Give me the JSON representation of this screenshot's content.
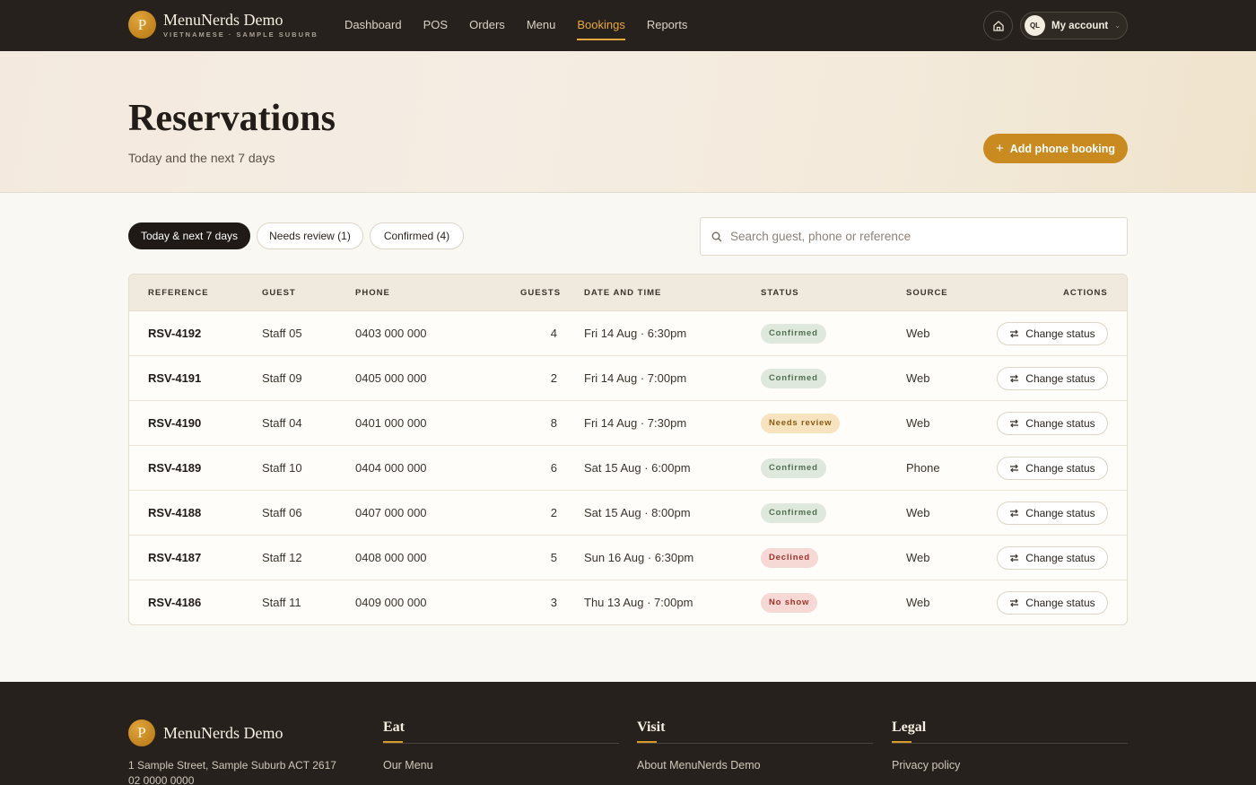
{
  "brand": {
    "logo_letter": "P",
    "name": "MenuNerds Demo",
    "tagline": "VIETNAMESE · SAMPLE SUBURB"
  },
  "nav": [
    {
      "label": "Dashboard",
      "active": false
    },
    {
      "label": "POS",
      "active": false
    },
    {
      "label": "Orders",
      "active": false
    },
    {
      "label": "Menu",
      "active": false
    },
    {
      "label": "Bookings",
      "active": true
    },
    {
      "label": "Reports",
      "active": false
    }
  ],
  "account": {
    "initials": "QL",
    "label": "My account",
    "home_icon": "home-icon"
  },
  "hero": {
    "title": "Reservations",
    "subtitle": "Today and the next 7 days",
    "add_button": "Add phone booking"
  },
  "filters": [
    {
      "label": "Today & next 7 days",
      "active": true
    },
    {
      "label": "Needs review (1)",
      "active": false
    },
    {
      "label": "Confirmed (4)",
      "active": false
    }
  ],
  "search": {
    "placeholder": "Search guest, phone or reference",
    "value": ""
  },
  "table": {
    "columns": [
      "REFERENCE",
      "GUEST",
      "PHONE",
      "GUESTS",
      "DATE AND TIME",
      "STATUS",
      "SOURCE",
      "ACTIONS"
    ],
    "action_label": "Change status",
    "rows": [
      {
        "reference": "RSV-4192",
        "guest": "Staff 05",
        "phone": "0403 000 000",
        "guests": "4",
        "datetime": "Fri 14 Aug · 6:30pm",
        "status": "Confirmed",
        "status_kind": "confirmed",
        "source": "Web"
      },
      {
        "reference": "RSV-4191",
        "guest": "Staff 09",
        "phone": "0405 000 000",
        "guests": "2",
        "datetime": "Fri 14 Aug · 7:00pm",
        "status": "Confirmed",
        "status_kind": "confirmed",
        "source": "Web"
      },
      {
        "reference": "RSV-4190",
        "guest": "Staff 04",
        "phone": "0401 000 000",
        "guests": "8",
        "datetime": "Fri 14 Aug · 7:30pm",
        "status": "Needs review",
        "status_kind": "review",
        "source": "Web"
      },
      {
        "reference": "RSV-4189",
        "guest": "Staff 10",
        "phone": "0404 000 000",
        "guests": "6",
        "datetime": "Sat 15 Aug · 6:00pm",
        "status": "Confirmed",
        "status_kind": "confirmed",
        "source": "Phone"
      },
      {
        "reference": "RSV-4188",
        "guest": "Staff 06",
        "phone": "0407 000 000",
        "guests": "2",
        "datetime": "Sat 15 Aug · 8:00pm",
        "status": "Confirmed",
        "status_kind": "confirmed",
        "source": "Web"
      },
      {
        "reference": "RSV-4187",
        "guest": "Staff 12",
        "phone": "0408 000 000",
        "guests": "5",
        "datetime": "Sun 16 Aug · 6:30pm",
        "status": "Declined",
        "status_kind": "declined",
        "source": "Web"
      },
      {
        "reference": "RSV-4186",
        "guest": "Staff 11",
        "phone": "0409 000 000",
        "guests": "3",
        "datetime": "Thu 13 Aug · 7:00pm",
        "status": "No show",
        "status_kind": "noshow",
        "source": "Web"
      }
    ]
  },
  "status_colors": {
    "confirmed": {
      "bg": "#dfe8dc",
      "fg": "#4f6f52"
    },
    "review": {
      "bg": "#f7e4bf",
      "fg": "#8a5a12"
    },
    "declined": {
      "bg": "#f6d8d5",
      "fg": "#a3342b"
    },
    "noshow": {
      "bg": "#f6d8d5",
      "fg": "#a3342b"
    }
  },
  "footer": {
    "brand_name": "MenuNerds Demo",
    "address": "1 Sample Street, Sample Suburb ACT 2617",
    "phone": "02 0000 0000",
    "columns": [
      {
        "heading": "Eat",
        "link": "Our Menu"
      },
      {
        "heading": "Visit",
        "link": "About MenuNerds Demo"
      },
      {
        "heading": "Legal",
        "link": "Privacy policy"
      }
    ]
  }
}
